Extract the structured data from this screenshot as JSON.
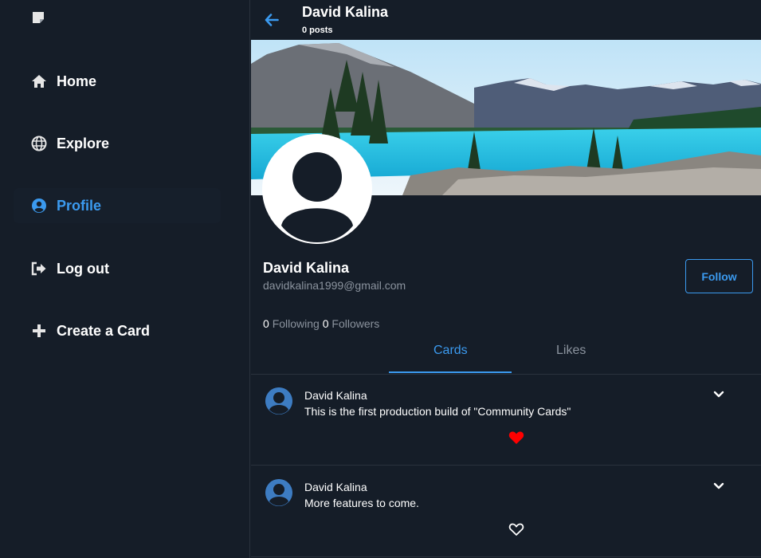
{
  "sidebar": {
    "items": [
      {
        "label": "Home",
        "icon": "home-icon"
      },
      {
        "label": "Explore",
        "icon": "globe-icon"
      },
      {
        "label": "Profile",
        "icon": "user-circle-icon"
      },
      {
        "label": "Log out",
        "icon": "logout-icon"
      },
      {
        "label": "Create a Card",
        "icon": "plus-icon"
      }
    ],
    "active_index": 2
  },
  "header": {
    "name": "David Kalina",
    "posts": "0 posts"
  },
  "profile": {
    "name": "David Kalina",
    "email": "davidkalina1999@gmail.com",
    "follow_label": "Follow",
    "following_count": "0",
    "following_label": "Following",
    "followers_count": "0",
    "followers_label": "Followers"
  },
  "tabs": [
    {
      "label": "Cards",
      "active": true
    },
    {
      "label": "Likes",
      "active": false
    }
  ],
  "cards": [
    {
      "author": "David Kalina",
      "text": "This is the first production build of \"Community Cards\"",
      "liked": true
    },
    {
      "author": "David Kalina",
      "text": "More features to come.",
      "liked": false
    }
  ],
  "colors": {
    "background": "#151d28",
    "accent": "#3b9aef",
    "muted": "#8b939e",
    "like": "#ff0000",
    "divider": "#2a323d"
  }
}
